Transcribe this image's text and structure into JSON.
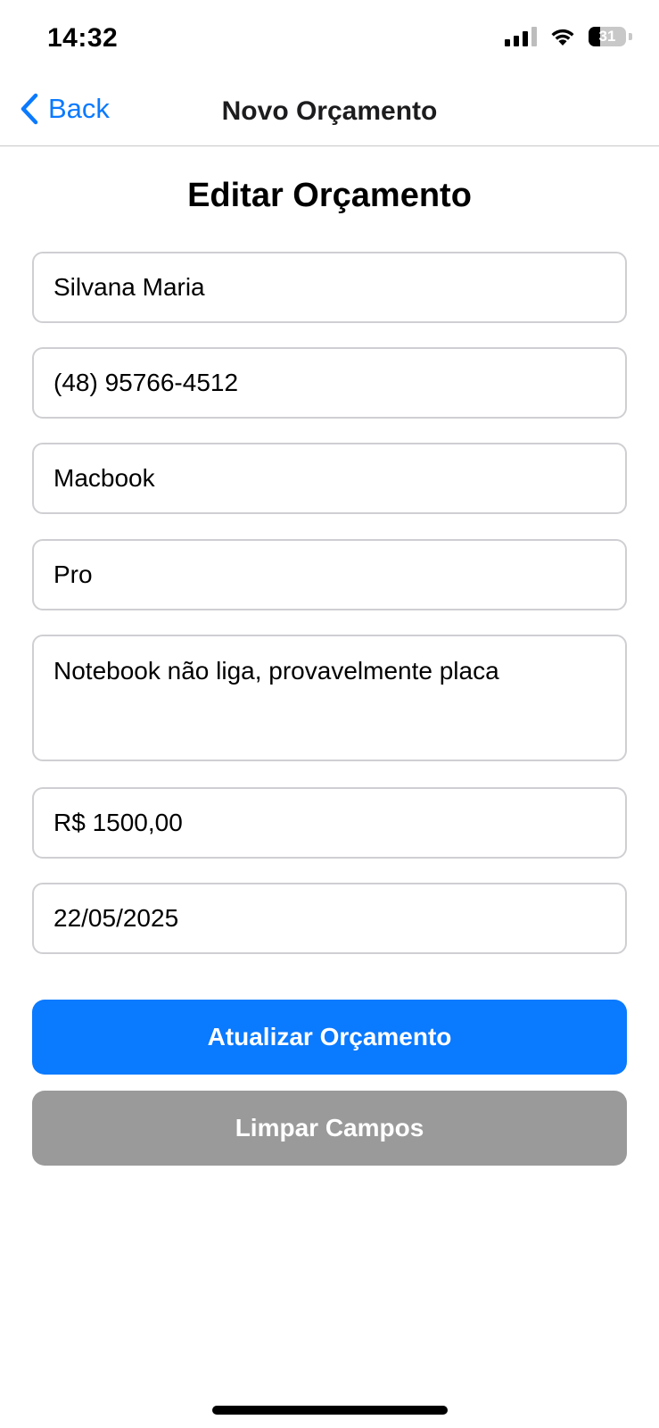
{
  "status_bar": {
    "time": "14:32",
    "battery_level": "31",
    "battery_fraction": 0.31,
    "icons": [
      "signal-icon",
      "wifi-icon",
      "battery-icon"
    ]
  },
  "nav": {
    "back_label": "Back",
    "title": "Novo Orçamento",
    "accent_color": "#0a7aff"
  },
  "form": {
    "heading": "Editar Orçamento",
    "fields": {
      "client_name": "Silvana Maria",
      "phone": "(48) 95766-4512",
      "device": "Macbook",
      "model": "Pro",
      "problem_description": "Notebook não liga, provavelmente placa",
      "price": "R$ 1500,00",
      "date": "22/05/2025"
    },
    "update_button_label": "Atualizar Orçamento",
    "clear_button_label": "Limpar Campos",
    "primary_color": "#0a7aff",
    "secondary_color": "#9a9a9a"
  }
}
